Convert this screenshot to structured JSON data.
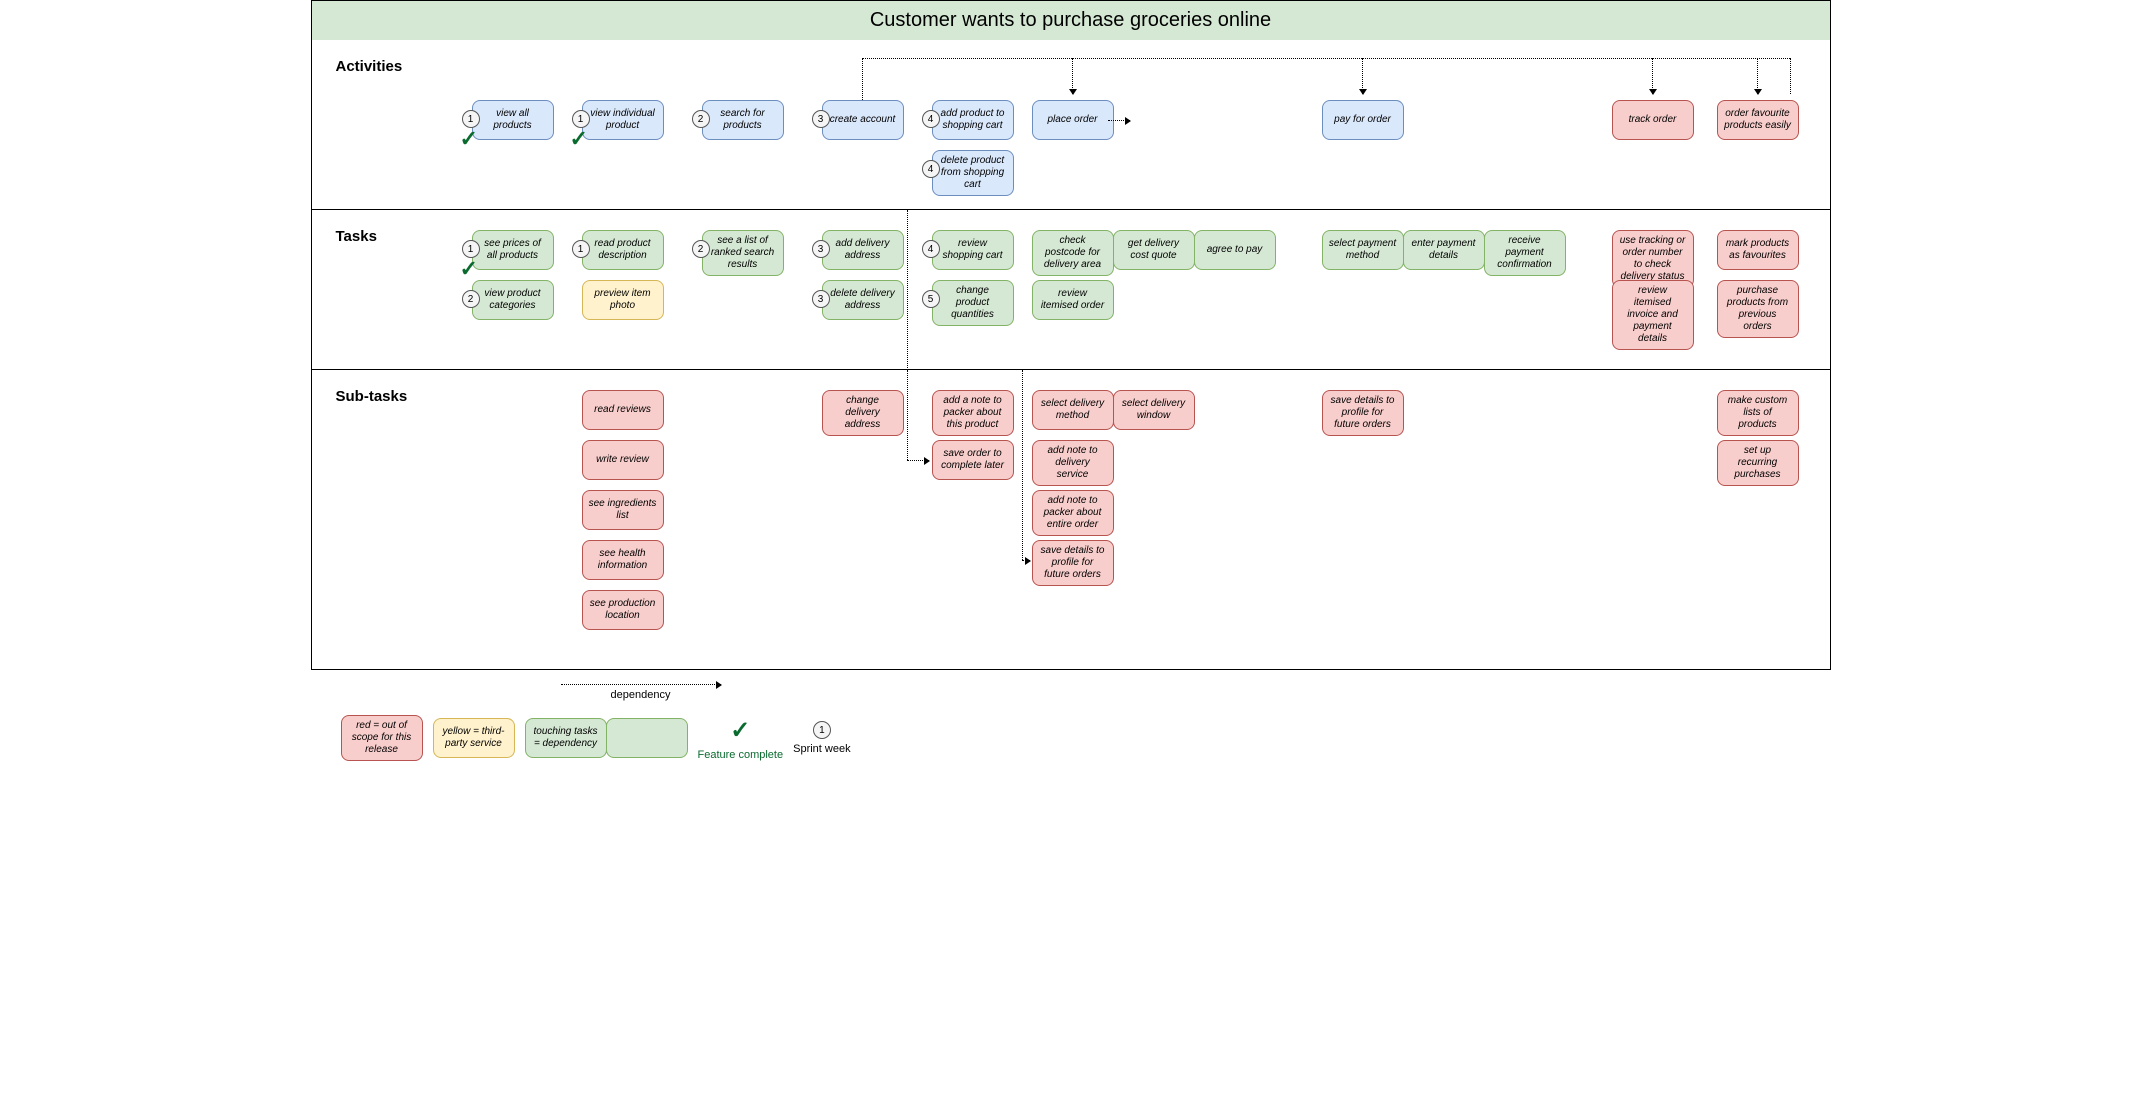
{
  "title": "Customer wants to purchase groceries online",
  "rows": {
    "activities": "Activities",
    "tasks": "Tasks",
    "subtasks": "Sub-tasks"
  },
  "activities": {
    "view_all_products": "view all products",
    "view_individual_product": "view individual product",
    "search_for_products": "search for products",
    "create_account": "create account",
    "add_product_to_cart": "add product to shopping cart",
    "delete_product_from_cart": "delete product from shopping cart",
    "place_order": "place order",
    "pay_for_order": "pay for order",
    "track_order": "track order",
    "order_favourite": "order favourite products easily"
  },
  "tasks": {
    "see_prices": "see prices of all products",
    "view_categories": "view product categories",
    "read_description": "read product description",
    "preview_photo": "preview item photo",
    "ranked_results": "see a list of ranked search results",
    "add_address": "add delivery address",
    "delete_address": "delete delivery address",
    "review_cart": "review shopping cart",
    "change_qty": "change product quantities",
    "check_postcode": "check postcode for delivery area",
    "delivery_quote": "get delivery cost quote",
    "agree_pay": "agree to pay",
    "review_itemised": "review itemised order",
    "select_payment": "select payment method",
    "enter_payment": "enter payment details",
    "receive_confirm": "receive payment confirmation",
    "use_tracking": "use tracking or order number to check delivery status",
    "review_invoice": "review itemised invoice and payment details",
    "mark_favourites": "mark products as favourites",
    "purchase_previous": "purchase products from previous orders"
  },
  "subtasks": {
    "read_reviews": "read reviews",
    "write_review": "write review",
    "see_ingredients": "see ingredients list",
    "see_health": "see health information",
    "see_production": "see production location",
    "change_address": "change delivery address",
    "add_note_product": "add a note to packer about this product",
    "save_order_later": "save order to complete later",
    "select_delivery_method": "select delivery method",
    "select_delivery_window": "select delivery window",
    "add_note_delivery": "add note to delivery service",
    "add_note_packer_order": "add note to packer about entire order",
    "save_profile_place": "save details to profile for future orders",
    "save_profile_pay": "save details to profile for future orders",
    "make_custom_lists": "make custom lists of products",
    "recurring": "set up recurring purchases"
  },
  "badges": {
    "one": "1",
    "two": "2",
    "three": "3",
    "four": "4",
    "five": "5"
  },
  "legend": {
    "dependency": "dependency",
    "red": "red = out of scope for this release",
    "yellow": "yellow = third-party service",
    "touching": "touching tasks = dependency",
    "feature_complete": "Feature complete",
    "sprint_week": "Sprint week"
  }
}
